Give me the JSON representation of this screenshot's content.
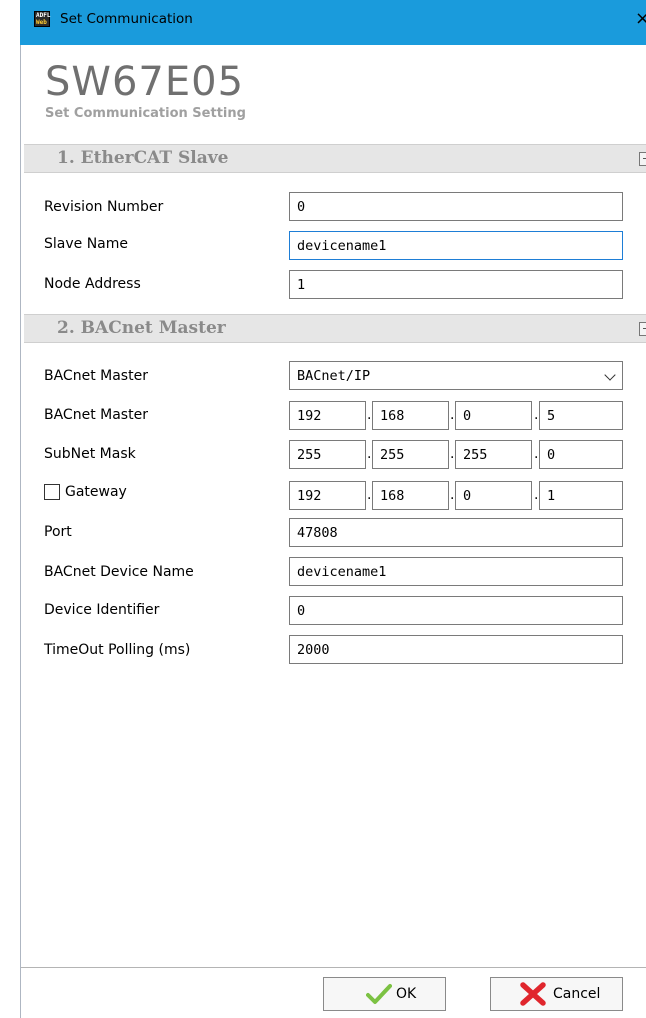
{
  "window": {
    "title": "Set Communication",
    "icon_text_top": "ADFL",
    "icon_text_bottom": "Web",
    "close": "×"
  },
  "header": {
    "app_name": "SW67E05",
    "subtitle": "Set Communication Setting"
  },
  "section1": {
    "title": "1. EtherCAT Slave",
    "fields": {
      "revision_number": {
        "label": "Revision Number",
        "value": "0"
      },
      "slave_name": {
        "label": "Slave Name",
        "value": "devicename1"
      },
      "node_address": {
        "label": "Node Address",
        "value": "1"
      }
    }
  },
  "section2": {
    "title": "2. BACnet Master",
    "bacnet_master_type": {
      "label": "BACnet Master",
      "value": "BACnet/IP",
      "icon": "chevron-down-icon"
    },
    "bacnet_master_ip": {
      "label": "BACnet Master",
      "octets": [
        "192",
        "168",
        "0",
        "5"
      ]
    },
    "subnet_mask": {
      "label": "SubNet Mask",
      "octets": [
        "255",
        "255",
        "255",
        "0"
      ]
    },
    "gateway": {
      "label": "Gateway",
      "checked": false,
      "octets": [
        "192",
        "168",
        "0",
        "1"
      ]
    },
    "port": {
      "label": "Port",
      "value": "47808"
    },
    "device_name": {
      "label": "BACnet Device Name",
      "value": "devicename1"
    },
    "device_identifier": {
      "label": "Device Identifier",
      "value": "0"
    },
    "timeout_polling": {
      "label": "TimeOut Polling (ms)",
      "value": "2000"
    }
  },
  "buttons": {
    "ok": "OK",
    "cancel": "Cancel",
    "ok_icon": "checkmark-icon",
    "cancel_icon": "red-x-icon"
  },
  "colors": {
    "titlebar": "#1a9bdc",
    "ok_check": "#7cc243",
    "cancel_x": "#e0262d"
  }
}
